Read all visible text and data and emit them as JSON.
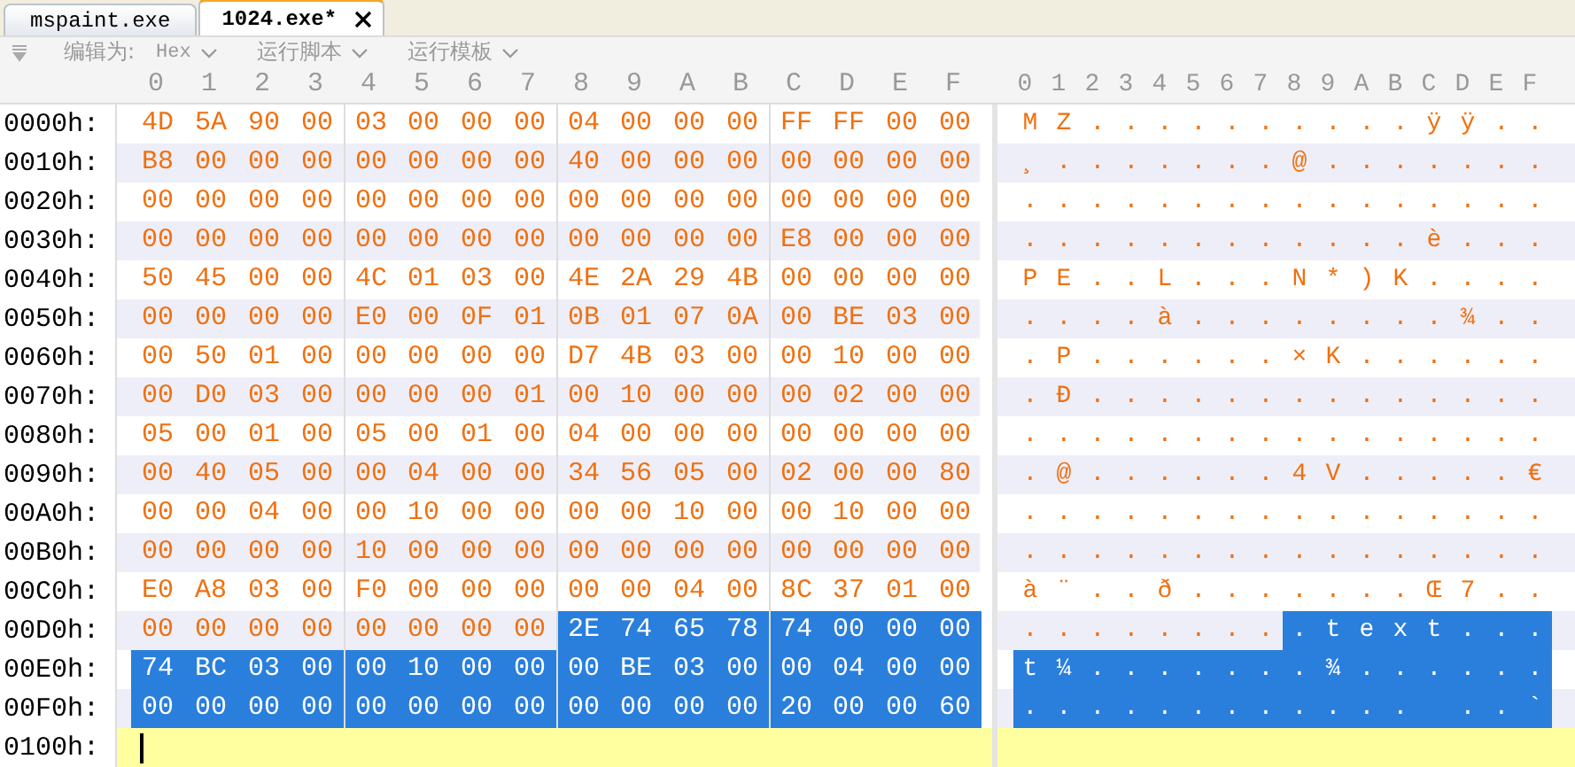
{
  "tabs": [
    {
      "label": "mspaint.exe",
      "selected": false,
      "closable": false
    },
    {
      "label": "1024.exe*",
      "selected": true,
      "closable": true
    }
  ],
  "toolbar": {
    "edit_as_label": "编辑为:",
    "edit_as_value": "Hex",
    "menus": [
      "运行脚本",
      "运行模板"
    ]
  },
  "hex_columns": [
    "0",
    "1",
    "2",
    "3",
    "4",
    "5",
    "6",
    "7",
    "8",
    "9",
    "A",
    "B",
    "C",
    "D",
    "E",
    "F"
  ],
  "text_columns": [
    "0",
    "1",
    "2",
    "3",
    "4",
    "5",
    "6",
    "7",
    "8",
    "9",
    "A",
    "B",
    "C",
    "D",
    "E",
    "F"
  ],
  "rows": [
    {
      "kind": "data",
      "offset": "0000h:",
      "cells": [
        {
          "hex": "4D",
          "char": "M",
          "selected": false
        },
        {
          "hex": "5A",
          "char": "Z",
          "selected": false
        },
        {
          "hex": "90",
          "char": ".",
          "selected": false
        },
        {
          "hex": "00",
          "char": ".",
          "selected": false
        },
        {
          "hex": "03",
          "char": ".",
          "selected": false
        },
        {
          "hex": "00",
          "char": ".",
          "selected": false
        },
        {
          "hex": "00",
          "char": ".",
          "selected": false
        },
        {
          "hex": "00",
          "char": ".",
          "selected": false
        },
        {
          "hex": "04",
          "char": ".",
          "selected": false
        },
        {
          "hex": "00",
          "char": ".",
          "selected": false
        },
        {
          "hex": "00",
          "char": ".",
          "selected": false
        },
        {
          "hex": "00",
          "char": ".",
          "selected": false
        },
        {
          "hex": "FF",
          "char": "ÿ",
          "selected": false
        },
        {
          "hex": "FF",
          "char": "ÿ",
          "selected": false
        },
        {
          "hex": "00",
          "char": ".",
          "selected": false
        },
        {
          "hex": "00",
          "char": ".",
          "selected": false
        }
      ]
    },
    {
      "kind": "data",
      "offset": "0010h:",
      "cells": [
        {
          "hex": "B8",
          "char": "¸",
          "selected": false
        },
        {
          "hex": "00",
          "char": ".",
          "selected": false
        },
        {
          "hex": "00",
          "char": ".",
          "selected": false
        },
        {
          "hex": "00",
          "char": ".",
          "selected": false
        },
        {
          "hex": "00",
          "char": ".",
          "selected": false
        },
        {
          "hex": "00",
          "char": ".",
          "selected": false
        },
        {
          "hex": "00",
          "char": ".",
          "selected": false
        },
        {
          "hex": "00",
          "char": ".",
          "selected": false
        },
        {
          "hex": "40",
          "char": "@",
          "selected": false
        },
        {
          "hex": "00",
          "char": ".",
          "selected": false
        },
        {
          "hex": "00",
          "char": ".",
          "selected": false
        },
        {
          "hex": "00",
          "char": ".",
          "selected": false
        },
        {
          "hex": "00",
          "char": ".",
          "selected": false
        },
        {
          "hex": "00",
          "char": ".",
          "selected": false
        },
        {
          "hex": "00",
          "char": ".",
          "selected": false
        },
        {
          "hex": "00",
          "char": ".",
          "selected": false
        }
      ]
    },
    {
      "kind": "data",
      "offset": "0020h:",
      "cells": [
        {
          "hex": "00",
          "char": ".",
          "selected": false
        },
        {
          "hex": "00",
          "char": ".",
          "selected": false
        },
        {
          "hex": "00",
          "char": ".",
          "selected": false
        },
        {
          "hex": "00",
          "char": ".",
          "selected": false
        },
        {
          "hex": "00",
          "char": ".",
          "selected": false
        },
        {
          "hex": "00",
          "char": ".",
          "selected": false
        },
        {
          "hex": "00",
          "char": ".",
          "selected": false
        },
        {
          "hex": "00",
          "char": ".",
          "selected": false
        },
        {
          "hex": "00",
          "char": ".",
          "selected": false
        },
        {
          "hex": "00",
          "char": ".",
          "selected": false
        },
        {
          "hex": "00",
          "char": ".",
          "selected": false
        },
        {
          "hex": "00",
          "char": ".",
          "selected": false
        },
        {
          "hex": "00",
          "char": ".",
          "selected": false
        },
        {
          "hex": "00",
          "char": ".",
          "selected": false
        },
        {
          "hex": "00",
          "char": ".",
          "selected": false
        },
        {
          "hex": "00",
          "char": ".",
          "selected": false
        }
      ]
    },
    {
      "kind": "data",
      "offset": "0030h:",
      "cells": [
        {
          "hex": "00",
          "char": ".",
          "selected": false
        },
        {
          "hex": "00",
          "char": ".",
          "selected": false
        },
        {
          "hex": "00",
          "char": ".",
          "selected": false
        },
        {
          "hex": "00",
          "char": ".",
          "selected": false
        },
        {
          "hex": "00",
          "char": ".",
          "selected": false
        },
        {
          "hex": "00",
          "char": ".",
          "selected": false
        },
        {
          "hex": "00",
          "char": ".",
          "selected": false
        },
        {
          "hex": "00",
          "char": ".",
          "selected": false
        },
        {
          "hex": "00",
          "char": ".",
          "selected": false
        },
        {
          "hex": "00",
          "char": ".",
          "selected": false
        },
        {
          "hex": "00",
          "char": ".",
          "selected": false
        },
        {
          "hex": "00",
          "char": ".",
          "selected": false
        },
        {
          "hex": "E8",
          "char": "è",
          "selected": false
        },
        {
          "hex": "00",
          "char": ".",
          "selected": false
        },
        {
          "hex": "00",
          "char": ".",
          "selected": false
        },
        {
          "hex": "00",
          "char": ".",
          "selected": false
        }
      ]
    },
    {
      "kind": "data",
      "offset": "0040h:",
      "cells": [
        {
          "hex": "50",
          "char": "P",
          "selected": false
        },
        {
          "hex": "45",
          "char": "E",
          "selected": false
        },
        {
          "hex": "00",
          "char": ".",
          "selected": false
        },
        {
          "hex": "00",
          "char": ".",
          "selected": false
        },
        {
          "hex": "4C",
          "char": "L",
          "selected": false
        },
        {
          "hex": "01",
          "char": ".",
          "selected": false
        },
        {
          "hex": "03",
          "char": ".",
          "selected": false
        },
        {
          "hex": "00",
          "char": ".",
          "selected": false
        },
        {
          "hex": "4E",
          "char": "N",
          "selected": false
        },
        {
          "hex": "2A",
          "char": "*",
          "selected": false
        },
        {
          "hex": "29",
          "char": ")",
          "selected": false
        },
        {
          "hex": "4B",
          "char": "K",
          "selected": false
        },
        {
          "hex": "00",
          "char": ".",
          "selected": false
        },
        {
          "hex": "00",
          "char": ".",
          "selected": false
        },
        {
          "hex": "00",
          "char": ".",
          "selected": false
        },
        {
          "hex": "00",
          "char": ".",
          "selected": false
        }
      ]
    },
    {
      "kind": "data",
      "offset": "0050h:",
      "cells": [
        {
          "hex": "00",
          "char": ".",
          "selected": false
        },
        {
          "hex": "00",
          "char": ".",
          "selected": false
        },
        {
          "hex": "00",
          "char": ".",
          "selected": false
        },
        {
          "hex": "00",
          "char": ".",
          "selected": false
        },
        {
          "hex": "E0",
          "char": "à",
          "selected": false
        },
        {
          "hex": "00",
          "char": ".",
          "selected": false
        },
        {
          "hex": "0F",
          "char": ".",
          "selected": false
        },
        {
          "hex": "01",
          "char": ".",
          "selected": false
        },
        {
          "hex": "0B",
          "char": ".",
          "selected": false
        },
        {
          "hex": "01",
          "char": ".",
          "selected": false
        },
        {
          "hex": "07",
          "char": ".",
          "selected": false
        },
        {
          "hex": "0A",
          "char": ".",
          "selected": false
        },
        {
          "hex": "00",
          "char": ".",
          "selected": false
        },
        {
          "hex": "BE",
          "char": "¾",
          "selected": false
        },
        {
          "hex": "03",
          "char": ".",
          "selected": false
        },
        {
          "hex": "00",
          "char": ".",
          "selected": false
        }
      ]
    },
    {
      "kind": "data",
      "offset": "0060h:",
      "cells": [
        {
          "hex": "00",
          "char": ".",
          "selected": false
        },
        {
          "hex": "50",
          "char": "P",
          "selected": false
        },
        {
          "hex": "01",
          "char": ".",
          "selected": false
        },
        {
          "hex": "00",
          "char": ".",
          "selected": false
        },
        {
          "hex": "00",
          "char": ".",
          "selected": false
        },
        {
          "hex": "00",
          "char": ".",
          "selected": false
        },
        {
          "hex": "00",
          "char": ".",
          "selected": false
        },
        {
          "hex": "00",
          "char": ".",
          "selected": false
        },
        {
          "hex": "D7",
          "char": "×",
          "selected": false
        },
        {
          "hex": "4B",
          "char": "K",
          "selected": false
        },
        {
          "hex": "03",
          "char": ".",
          "selected": false
        },
        {
          "hex": "00",
          "char": ".",
          "selected": false
        },
        {
          "hex": "00",
          "char": ".",
          "selected": false
        },
        {
          "hex": "10",
          "char": ".",
          "selected": false
        },
        {
          "hex": "00",
          "char": ".",
          "selected": false
        },
        {
          "hex": "00",
          "char": ".",
          "selected": false
        }
      ]
    },
    {
      "kind": "data",
      "offset": "0070h:",
      "cells": [
        {
          "hex": "00",
          "char": ".",
          "selected": false
        },
        {
          "hex": "D0",
          "char": "Ð",
          "selected": false
        },
        {
          "hex": "03",
          "char": ".",
          "selected": false
        },
        {
          "hex": "00",
          "char": ".",
          "selected": false
        },
        {
          "hex": "00",
          "char": ".",
          "selected": false
        },
        {
          "hex": "00",
          "char": ".",
          "selected": false
        },
        {
          "hex": "00",
          "char": ".",
          "selected": false
        },
        {
          "hex": "01",
          "char": ".",
          "selected": false
        },
        {
          "hex": "00",
          "char": ".",
          "selected": false
        },
        {
          "hex": "10",
          "char": ".",
          "selected": false
        },
        {
          "hex": "00",
          "char": ".",
          "selected": false
        },
        {
          "hex": "00",
          "char": ".",
          "selected": false
        },
        {
          "hex": "00",
          "char": ".",
          "selected": false
        },
        {
          "hex": "02",
          "char": ".",
          "selected": false
        },
        {
          "hex": "00",
          "char": ".",
          "selected": false
        },
        {
          "hex": "00",
          "char": ".",
          "selected": false
        }
      ]
    },
    {
      "kind": "data",
      "offset": "0080h:",
      "cells": [
        {
          "hex": "05",
          "char": ".",
          "selected": false
        },
        {
          "hex": "00",
          "char": ".",
          "selected": false
        },
        {
          "hex": "01",
          "char": ".",
          "selected": false
        },
        {
          "hex": "00",
          "char": ".",
          "selected": false
        },
        {
          "hex": "05",
          "char": ".",
          "selected": false
        },
        {
          "hex": "00",
          "char": ".",
          "selected": false
        },
        {
          "hex": "01",
          "char": ".",
          "selected": false
        },
        {
          "hex": "00",
          "char": ".",
          "selected": false
        },
        {
          "hex": "04",
          "char": ".",
          "selected": false
        },
        {
          "hex": "00",
          "char": ".",
          "selected": false
        },
        {
          "hex": "00",
          "char": ".",
          "selected": false
        },
        {
          "hex": "00",
          "char": ".",
          "selected": false
        },
        {
          "hex": "00",
          "char": ".",
          "selected": false
        },
        {
          "hex": "00",
          "char": ".",
          "selected": false
        },
        {
          "hex": "00",
          "char": ".",
          "selected": false
        },
        {
          "hex": "00",
          "char": ".",
          "selected": false
        }
      ]
    },
    {
      "kind": "data",
      "offset": "0090h:",
      "cells": [
        {
          "hex": "00",
          "char": ".",
          "selected": false
        },
        {
          "hex": "40",
          "char": "@",
          "selected": false
        },
        {
          "hex": "05",
          "char": ".",
          "selected": false
        },
        {
          "hex": "00",
          "char": ".",
          "selected": false
        },
        {
          "hex": "00",
          "char": ".",
          "selected": false
        },
        {
          "hex": "04",
          "char": ".",
          "selected": false
        },
        {
          "hex": "00",
          "char": ".",
          "selected": false
        },
        {
          "hex": "00",
          "char": ".",
          "selected": false
        },
        {
          "hex": "34",
          "char": "4",
          "selected": false
        },
        {
          "hex": "56",
          "char": "V",
          "selected": false
        },
        {
          "hex": "05",
          "char": ".",
          "selected": false
        },
        {
          "hex": "00",
          "char": ".",
          "selected": false
        },
        {
          "hex": "02",
          "char": ".",
          "selected": false
        },
        {
          "hex": "00",
          "char": ".",
          "selected": false
        },
        {
          "hex": "00",
          "char": ".",
          "selected": false
        },
        {
          "hex": "80",
          "char": "€",
          "selected": false
        }
      ]
    },
    {
      "kind": "data",
      "offset": "00A0h:",
      "cells": [
        {
          "hex": "00",
          "char": ".",
          "selected": false
        },
        {
          "hex": "00",
          "char": ".",
          "selected": false
        },
        {
          "hex": "04",
          "char": ".",
          "selected": false
        },
        {
          "hex": "00",
          "char": ".",
          "selected": false
        },
        {
          "hex": "00",
          "char": ".",
          "selected": false
        },
        {
          "hex": "10",
          "char": ".",
          "selected": false
        },
        {
          "hex": "00",
          "char": ".",
          "selected": false
        },
        {
          "hex": "00",
          "char": ".",
          "selected": false
        },
        {
          "hex": "00",
          "char": ".",
          "selected": false
        },
        {
          "hex": "00",
          "char": ".",
          "selected": false
        },
        {
          "hex": "10",
          "char": ".",
          "selected": false
        },
        {
          "hex": "00",
          "char": ".",
          "selected": false
        },
        {
          "hex": "00",
          "char": ".",
          "selected": false
        },
        {
          "hex": "10",
          "char": ".",
          "selected": false
        },
        {
          "hex": "00",
          "char": ".",
          "selected": false
        },
        {
          "hex": "00",
          "char": ".",
          "selected": false
        }
      ]
    },
    {
      "kind": "data",
      "offset": "00B0h:",
      "cells": [
        {
          "hex": "00",
          "char": ".",
          "selected": false
        },
        {
          "hex": "00",
          "char": ".",
          "selected": false
        },
        {
          "hex": "00",
          "char": ".",
          "selected": false
        },
        {
          "hex": "00",
          "char": ".",
          "selected": false
        },
        {
          "hex": "10",
          "char": ".",
          "selected": false
        },
        {
          "hex": "00",
          "char": ".",
          "selected": false
        },
        {
          "hex": "00",
          "char": ".",
          "selected": false
        },
        {
          "hex": "00",
          "char": ".",
          "selected": false
        },
        {
          "hex": "00",
          "char": ".",
          "selected": false
        },
        {
          "hex": "00",
          "char": ".",
          "selected": false
        },
        {
          "hex": "00",
          "char": ".",
          "selected": false
        },
        {
          "hex": "00",
          "char": ".",
          "selected": false
        },
        {
          "hex": "00",
          "char": ".",
          "selected": false
        },
        {
          "hex": "00",
          "char": ".",
          "selected": false
        },
        {
          "hex": "00",
          "char": ".",
          "selected": false
        },
        {
          "hex": "00",
          "char": ".",
          "selected": false
        }
      ]
    },
    {
      "kind": "data",
      "offset": "00C0h:",
      "cells": [
        {
          "hex": "E0",
          "char": "à",
          "selected": false
        },
        {
          "hex": "A8",
          "char": "¨",
          "selected": false
        },
        {
          "hex": "03",
          "char": ".",
          "selected": false
        },
        {
          "hex": "00",
          "char": ".",
          "selected": false
        },
        {
          "hex": "F0",
          "char": "ð",
          "selected": false
        },
        {
          "hex": "00",
          "char": ".",
          "selected": false
        },
        {
          "hex": "00",
          "char": ".",
          "selected": false
        },
        {
          "hex": "00",
          "char": ".",
          "selected": false
        },
        {
          "hex": "00",
          "char": ".",
          "selected": false
        },
        {
          "hex": "00",
          "char": ".",
          "selected": false
        },
        {
          "hex": "04",
          "char": ".",
          "selected": false
        },
        {
          "hex": "00",
          "char": ".",
          "selected": false
        },
        {
          "hex": "8C",
          "char": "Œ",
          "selected": false
        },
        {
          "hex": "37",
          "char": "7",
          "selected": false
        },
        {
          "hex": "01",
          "char": ".",
          "selected": false
        },
        {
          "hex": "00",
          "char": ".",
          "selected": false
        }
      ]
    },
    {
      "kind": "data",
      "offset": "00D0h:",
      "cells": [
        {
          "hex": "00",
          "char": ".",
          "selected": false
        },
        {
          "hex": "00",
          "char": ".",
          "selected": false
        },
        {
          "hex": "00",
          "char": ".",
          "selected": false
        },
        {
          "hex": "00",
          "char": ".",
          "selected": false
        },
        {
          "hex": "00",
          "char": ".",
          "selected": false
        },
        {
          "hex": "00",
          "char": ".",
          "selected": false
        },
        {
          "hex": "00",
          "char": ".",
          "selected": false
        },
        {
          "hex": "00",
          "char": ".",
          "selected": false
        },
        {
          "hex": "2E",
          "char": ".",
          "selected": true
        },
        {
          "hex": "74",
          "char": "t",
          "selected": true
        },
        {
          "hex": "65",
          "char": "e",
          "selected": true
        },
        {
          "hex": "78",
          "char": "x",
          "selected": true
        },
        {
          "hex": "74",
          "char": "t",
          "selected": true
        },
        {
          "hex": "00",
          "char": ".",
          "selected": true
        },
        {
          "hex": "00",
          "char": ".",
          "selected": true
        },
        {
          "hex": "00",
          "char": ".",
          "selected": true
        }
      ]
    },
    {
      "kind": "data",
      "offset": "00E0h:",
      "cells": [
        {
          "hex": "74",
          "char": "t",
          "selected": true
        },
        {
          "hex": "BC",
          "char": "¼",
          "selected": true
        },
        {
          "hex": "03",
          "char": ".",
          "selected": true
        },
        {
          "hex": "00",
          "char": ".",
          "selected": true
        },
        {
          "hex": "00",
          "char": ".",
          "selected": true
        },
        {
          "hex": "10",
          "char": ".",
          "selected": true
        },
        {
          "hex": "00",
          "char": ".",
          "selected": true
        },
        {
          "hex": "00",
          "char": ".",
          "selected": true
        },
        {
          "hex": "00",
          "char": ".",
          "selected": true
        },
        {
          "hex": "BE",
          "char": "¾",
          "selected": true
        },
        {
          "hex": "03",
          "char": ".",
          "selected": true
        },
        {
          "hex": "00",
          "char": ".",
          "selected": true
        },
        {
          "hex": "00",
          "char": ".",
          "selected": true
        },
        {
          "hex": "04",
          "char": ".",
          "selected": true
        },
        {
          "hex": "00",
          "char": ".",
          "selected": true
        },
        {
          "hex": "00",
          "char": ".",
          "selected": true
        }
      ]
    },
    {
      "kind": "data",
      "offset": "00F0h:",
      "cells": [
        {
          "hex": "00",
          "char": ".",
          "selected": true
        },
        {
          "hex": "00",
          "char": ".",
          "selected": true
        },
        {
          "hex": "00",
          "char": ".",
          "selected": true
        },
        {
          "hex": "00",
          "char": ".",
          "selected": true
        },
        {
          "hex": "00",
          "char": ".",
          "selected": true
        },
        {
          "hex": "00",
          "char": ".",
          "selected": true
        },
        {
          "hex": "00",
          "char": ".",
          "selected": true
        },
        {
          "hex": "00",
          "char": ".",
          "selected": true
        },
        {
          "hex": "00",
          "char": ".",
          "selected": true
        },
        {
          "hex": "00",
          "char": ".",
          "selected": true
        },
        {
          "hex": "00",
          "char": ".",
          "selected": true
        },
        {
          "hex": "00",
          "char": ".",
          "selected": true
        },
        {
          "hex": "20",
          "selected": true
        },
        {
          "hex": "00",
          "char": ".",
          "selected": true
        },
        {
          "hex": "00",
          "char": ".",
          "selected": true
        },
        {
          "hex": "60",
          "char": "`",
          "selected": true
        }
      ]
    },
    {
      "kind": "cursor",
      "offset": "0100h:",
      "cells": []
    }
  ]
}
